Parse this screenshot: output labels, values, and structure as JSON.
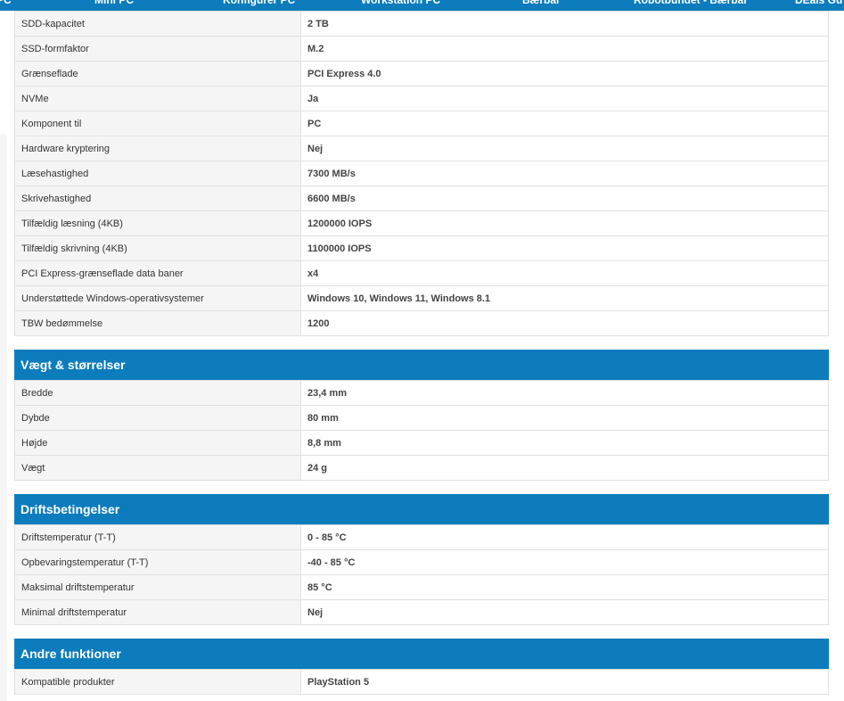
{
  "top_nav": {
    "items": [
      "PC",
      "Mini PC",
      "Konfigurer PC",
      "Workstation PC",
      "Bærbar",
      "Robotbundet - Bærbar",
      "DEals Gu"
    ]
  },
  "spec_rows": [
    {
      "label": "SDD-kapacitet",
      "value": "2 TB"
    },
    {
      "label": "SSD-formfaktor",
      "value": "M.2"
    },
    {
      "label": "Grænseflade",
      "value": "PCI Express 4.0"
    },
    {
      "label": "NVMe",
      "value": "Ja"
    },
    {
      "label": "Komponent til",
      "value": "PC"
    },
    {
      "label": "Hardware kryptering",
      "value": "Nej"
    },
    {
      "label": "Læsehastighed",
      "value": "7300 MB/s"
    },
    {
      "label": "Skrivehastighed",
      "value": "6600 MB/s"
    },
    {
      "label": "Tilfældig læsning (4KB)",
      "value": "1200000 IOPS"
    },
    {
      "label": "Tilfældig skrivning (4KB)",
      "value": "1100000 IOPS"
    },
    {
      "label": "PCI Express-grænseflade data baner",
      "value": "x4"
    },
    {
      "label": "Understøttede Windows-operativsystemer",
      "value": "Windows 10, Windows 11, Windows 8.1"
    },
    {
      "label": "TBW bedømmelse",
      "value": "1200"
    }
  ],
  "sections": [
    {
      "title": "Vægt & størrelser",
      "rows": [
        {
          "label": "Bredde",
          "value": "23,4 mm"
        },
        {
          "label": "Dybde",
          "value": "80 mm"
        },
        {
          "label": "Højde",
          "value": "8,8 mm"
        },
        {
          "label": "Vægt",
          "value": "24 g"
        }
      ]
    },
    {
      "title": "Driftsbetingelser",
      "rows": [
        {
          "label": "Driftstemperatur (T-T)",
          "value": "0 - 85 °C"
        },
        {
          "label": "Opbevaringstemperatur (T-T)",
          "value": "-40 - 85 °C"
        },
        {
          "label": "Maksimal driftstemperatur",
          "value": "85 °C"
        },
        {
          "label": "Minimal driftstemperatur",
          "value": "Nej"
        }
      ]
    },
    {
      "title": "Andre funktioner",
      "rows": [
        {
          "label": "Kompatible produkter",
          "value": "PlayStation 5"
        }
      ]
    }
  ]
}
